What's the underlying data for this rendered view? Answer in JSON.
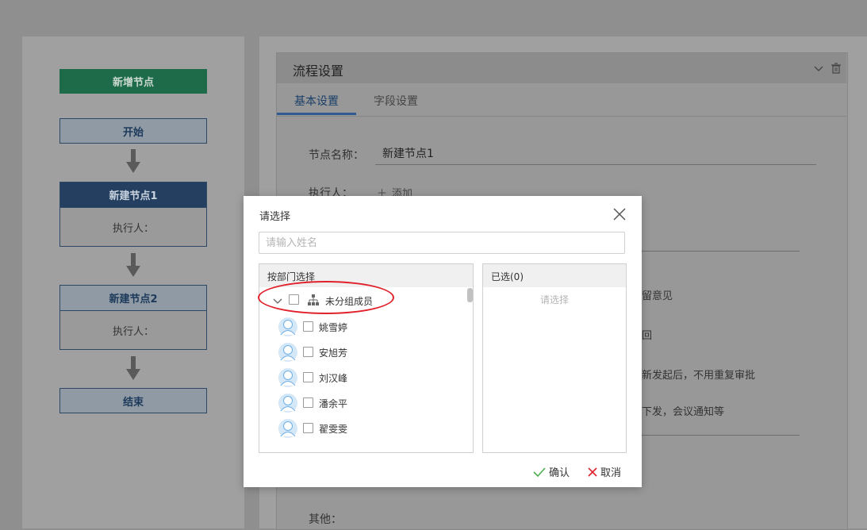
{
  "flow": {
    "add_node_label": "新增节点",
    "start_label": "开始",
    "node1_title": "新建节点1",
    "node1_executor": "执行人：",
    "node2_title": "新建节点2",
    "node2_executor": "执行人：",
    "end_label": "结束"
  },
  "settings": {
    "title": "流程设置",
    "tabs": [
      {
        "label": "基本设置",
        "active": true
      },
      {
        "label": "字段设置",
        "active": false
      }
    ],
    "node_name_label": "节点名称：",
    "node_name_value": "新建节点1",
    "executor_label": "执行人：",
    "add_label": "添加",
    "obscured_texts": [
      "留意见",
      "回",
      "新发起后，不用重复审批",
      "下发，会议通知等"
    ],
    "other_label": "其他："
  },
  "dialog": {
    "title": "请选择",
    "search_placeholder": "请输入姓名",
    "dept_header": "按部门选择",
    "group_name": "未分组成员",
    "members": [
      {
        "name": "姚雪婷"
      },
      {
        "name": "安旭芳"
      },
      {
        "name": "刘汉峰"
      },
      {
        "name": "潘余平"
      },
      {
        "name": "翟雯雯"
      }
    ],
    "selected_header": "已选(0)",
    "selected_empty": "请选择",
    "confirm_label": "确认",
    "cancel_label": "取消"
  },
  "colors": {
    "accent": "#2f5a8f",
    "add_button": "#27a56a",
    "highlight_circle": "#e0212b",
    "confirm_icon": "#4caf50",
    "cancel_icon": "#e0212b"
  }
}
